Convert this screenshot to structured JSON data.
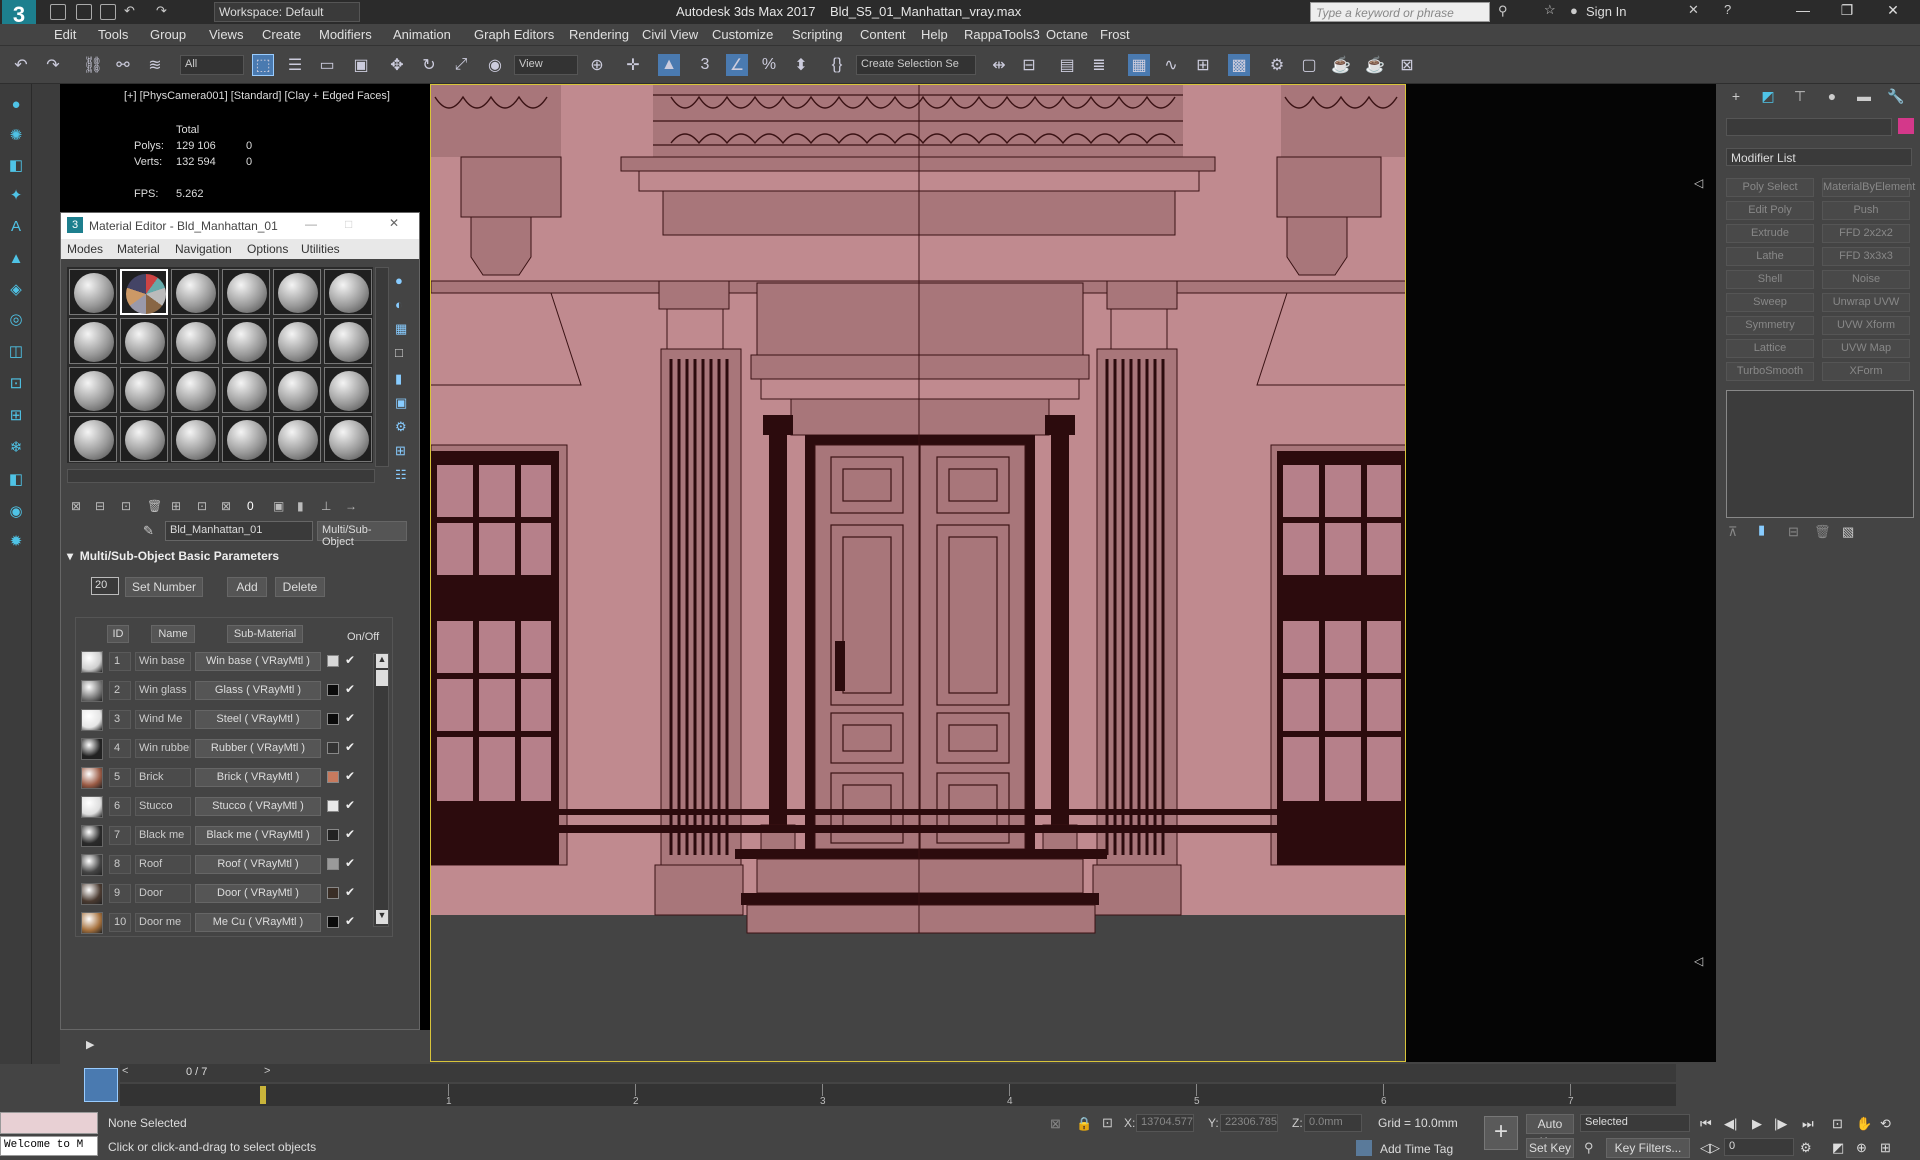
{
  "app": {
    "title": "Autodesk 3ds Max 2017",
    "file": "Bld_S5_01_Manhattan_vray.max",
    "workspace": "Workspace: Default",
    "search_placeholder": "Type a keyword or phrase",
    "sign_in": "Sign In"
  },
  "menu": [
    "Edit",
    "Tools",
    "Group",
    "Views",
    "Create",
    "Modifiers",
    "Animation",
    "Graph Editors",
    "Rendering",
    "Civil View",
    "Customize",
    "Scripting",
    "Content",
    "Help",
    "RappaTools3",
    "Octane",
    "Frost"
  ],
  "toolbar": {
    "filter": "All",
    "view": "View",
    "selection_set": "Create Selection Se"
  },
  "viewport": {
    "label": "[+] [PhysCamera001] [Standard] [Clay + Edged Faces]",
    "total_label": "Total",
    "polys_label": "Polys:",
    "polys_total": "129 106",
    "polys_sel": "0",
    "verts_label": "Verts:",
    "verts_total": "132 594",
    "verts_sel": "0",
    "fps_label": "FPS:",
    "fps": "5.262"
  },
  "material_editor": {
    "title": "Material Editor - Bld_Manhattan_01",
    "menu": [
      "Modes",
      "Material",
      "Navigation",
      "Options",
      "Utilities"
    ],
    "material_name": "Bld_Manhattan_01",
    "material_type": "Multi/Sub-Object",
    "rollout": "Multi/Sub-Object Basic Parameters",
    "count": "20",
    "set_number": "Set Number",
    "add": "Add",
    "delete": "Delete",
    "headers": {
      "id": "ID",
      "name": "Name",
      "sub": "Sub-Material",
      "onoff": "On/Off"
    },
    "rows": [
      {
        "id": "1",
        "name": "Win base",
        "sub": "Win base  ( VRayMtl )",
        "color": "#d8d8d8",
        "swatch": "#cfcfcf"
      },
      {
        "id": "2",
        "name": "Win glass",
        "sub": "Glass  ( VRayMtl )",
        "color": "#0a0a0a",
        "swatch": "#7a7a7a"
      },
      {
        "id": "3",
        "name": "Wind Me",
        "sub": "Steel  ( VRayMtl )",
        "color": "#0a0a0a",
        "swatch": "#e5e5e5"
      },
      {
        "id": "4",
        "name": "Win rubber",
        "sub": "Rubber  ( VRayMtl )",
        "color": "#333333",
        "swatch": "#222222"
      },
      {
        "id": "5",
        "name": "Brick",
        "sub": "Brick  ( VRayMtl )",
        "color": "#c77a5e",
        "swatch": "#9a5a44"
      },
      {
        "id": "6",
        "name": "Stucco",
        "sub": "Stucco  ( VRayMtl )",
        "color": "#e8e8e8",
        "swatch": "#dddddd"
      },
      {
        "id": "7",
        "name": "Black me",
        "sub": "Black me  ( VRayMtl )",
        "color": "#222222",
        "swatch": "#2a2a2a"
      },
      {
        "id": "8",
        "name": "Roof",
        "sub": "Roof  ( VRayMtl )",
        "color": "#9a9a9a",
        "swatch": "#444444"
      },
      {
        "id": "9",
        "name": "Door",
        "sub": "Door  ( VRayMtl )",
        "color": "#3a2e26",
        "swatch": "#4a3a30"
      },
      {
        "id": "10",
        "name": "Door me",
        "sub": "Me Cu  ( VRayMtl )",
        "color": "#0a0a0a",
        "swatch": "#a5703c"
      }
    ]
  },
  "command_panel": {
    "modifier_list": "Modifier List",
    "buttons": [
      [
        "Poly Select",
        "MaterialByElement"
      ],
      [
        "Edit Poly",
        "Push"
      ],
      [
        "Extrude",
        "FFD 2x2x2"
      ],
      [
        "Lathe",
        "FFD 3x3x3"
      ],
      [
        "Shell",
        "Noise"
      ],
      [
        "Sweep",
        "Unwrap UVW"
      ],
      [
        "Symmetry",
        "UVW Xform"
      ],
      [
        "Lattice",
        "UVW Map"
      ],
      [
        "TurboSmooth",
        "XForm"
      ]
    ]
  },
  "timeline": {
    "frame": "0 / 7",
    "ticks": [
      "1",
      "2",
      "3",
      "4",
      "5",
      "6",
      "7"
    ]
  },
  "status": {
    "selection": "None Selected",
    "prompt": "Click or click-and-drag to select objects",
    "listener": "Welcome to M",
    "x_label": "X:",
    "x": "13704.577",
    "y_label": "Y:",
    "y": "22306.785",
    "z_label": "Z:",
    "z": "0.0mm",
    "grid": "Grid = 10.0mm",
    "add_time_tag": "Add Time Tag",
    "auto_key": "Auto Key",
    "set_key": "Set Key",
    "selected": "Selected",
    "key_filters": "Key Filters...",
    "frame_field": "0"
  }
}
